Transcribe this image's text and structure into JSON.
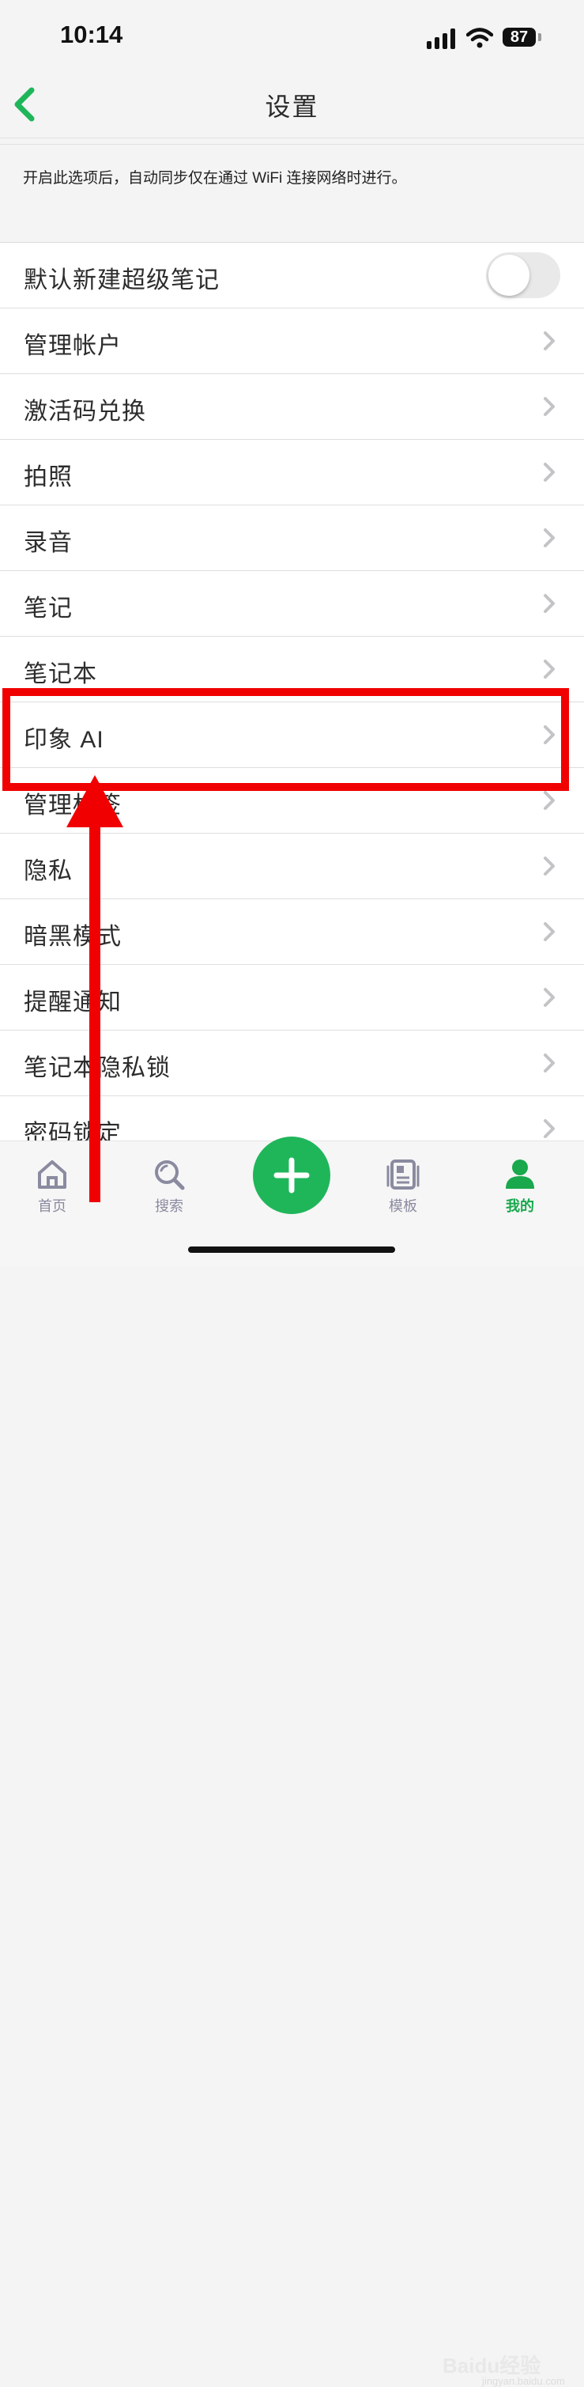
{
  "status_bar": {
    "time": "10:14",
    "battery": "87"
  },
  "nav": {
    "title": "设置"
  },
  "description": "开启此选项后，自动同步仅在通过 WiFi 连接网络时进行。",
  "settings": [
    {
      "label": "默认新建超级笔记",
      "control": "toggle",
      "toggle_on": false
    },
    {
      "label": "管理帐户",
      "control": "chevron"
    },
    {
      "label": "激活码兑换",
      "control": "chevron"
    },
    {
      "label": "拍照",
      "control": "chevron"
    },
    {
      "label": "录音",
      "control": "chevron"
    },
    {
      "label": "笔记",
      "control": "chevron"
    },
    {
      "label": "笔记本",
      "control": "chevron"
    },
    {
      "label": "印象 AI",
      "control": "chevron"
    },
    {
      "label": "管理标签",
      "control": "chevron"
    },
    {
      "label": "隐私",
      "control": "chevron"
    },
    {
      "label": "暗黑模式",
      "control": "chevron"
    },
    {
      "label": "提醒通知",
      "control": "chevron"
    },
    {
      "label": "笔记本隐私锁",
      "control": "chevron"
    },
    {
      "label": "密码锁定",
      "control": "chevron"
    }
  ],
  "tabs": [
    {
      "label": "首页",
      "icon": "home-icon"
    },
    {
      "label": "搜索",
      "icon": "search-icon"
    },
    {
      "label": "",
      "icon": "plus-icon"
    },
    {
      "label": "模板",
      "icon": "template-icon"
    },
    {
      "label": "我的",
      "icon": "profile-icon",
      "active": true
    }
  ],
  "watermark": {
    "text": "Baidu经验",
    "sub": "jingyan.baidu.com"
  },
  "colors": {
    "accent": "#1fb65a",
    "annotation": "#f00000",
    "chevron": "#c4c4c7"
  }
}
